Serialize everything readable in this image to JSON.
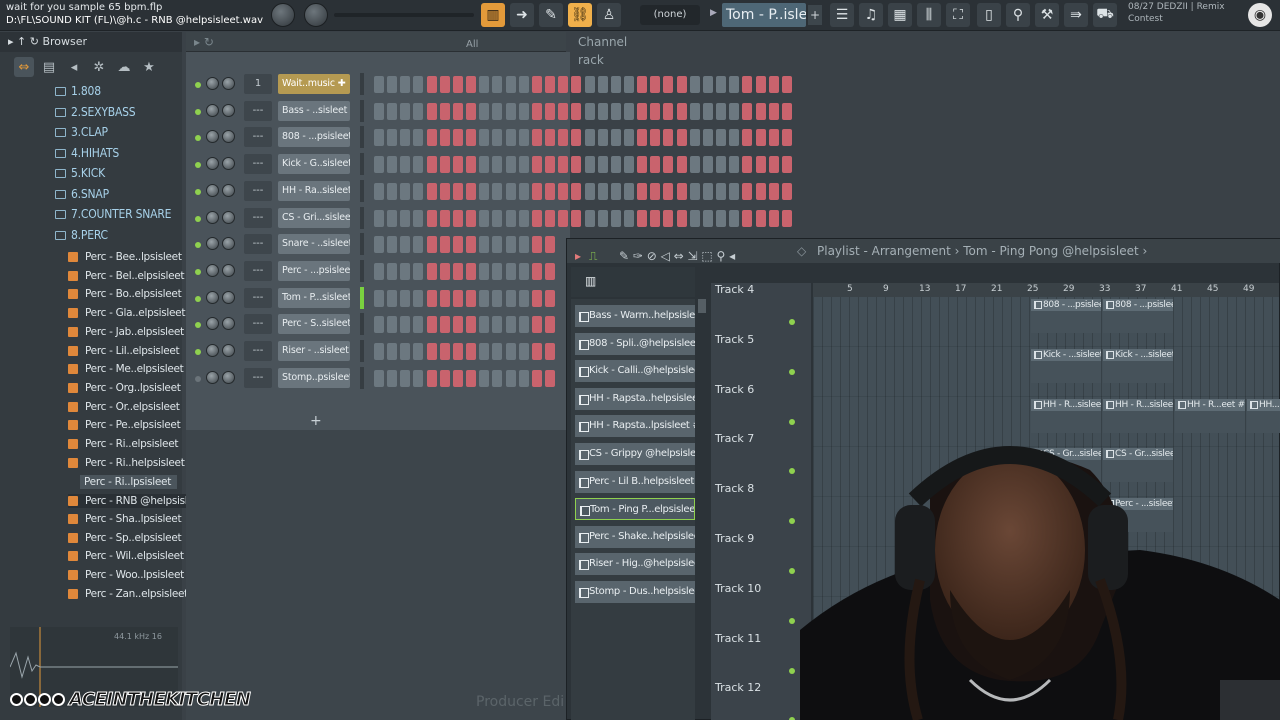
{
  "topbar": {
    "project_title": "wait for you sample 65 bpm.flp",
    "project_path": "D:\\FL\\SOUND KIT (FL)\\@h.c - RNB @helpsisleet.wav",
    "pattern_selector": "(none)",
    "current_pattern": "Tom - P..isleet",
    "news_line1": "08/27 DEDZII | Remix",
    "news_line2": "Contest"
  },
  "browser": {
    "title": "Browser",
    "folders": [
      "1.808",
      "2.SEXYBASS",
      "3.CLAP",
      "4.HIHATS",
      "5.KICK",
      "6.SNAP",
      "7.COUNTER SNARE",
      "8.PERC"
    ],
    "files": [
      "Perc - Bee..lpsisleet",
      "Perc - Bel..elpsisleet",
      "Perc - Bo..elpsisleet",
      "Perc - Gla..elpsisleet",
      "Perc - Jab..elpsisleet",
      "Perc - Lil..elpsisleet",
      "Perc - Me..elpsisleet",
      "Perc - Org..lpsisleet",
      "Perc - Or..elpsisleet",
      "Perc - Pe..elpsisleet",
      "Perc - Ri..elpsisleet",
      "Perc - Ri..helpsisleet"
    ],
    "drag_item": "Perc - Ri..lpsisleet",
    "selected_file": "Perc - RNB @helpsisleet",
    "files_after": [
      "Perc - Sha..lpsisleet",
      "Perc - Sp..elpsisleet",
      "Perc - Wil..elpsisleet",
      "Perc - Woo..lpsisleet",
      "Perc - Zan..elpsisleet"
    ],
    "sample_info": "44.1 kHz 16"
  },
  "channel_rack": {
    "filter": "All",
    "title": "Channel rack",
    "channels": [
      {
        "num": "1",
        "name": "Wait..music",
        "pattern": [
          1,
          1,
          1,
          1,
          1,
          1,
          1,
          1,
          1,
          1,
          1,
          1,
          1,
          1,
          1,
          1,
          1,
          1,
          1,
          1,
          1,
          1,
          1,
          1,
          1,
          1,
          1,
          1,
          1,
          1,
          1,
          1,
          1,
          1,
          1,
          1,
          1,
          1,
          1,
          1,
          1,
          1,
          1,
          1,
          1,
          1,
          1,
          1,
          1,
          1,
          1,
          1,
          1,
          1,
          1,
          1,
          1,
          1,
          1,
          1,
          1,
          1,
          1,
          1
        ]
      },
      {
        "num": "---",
        "name": "Bass - ..sisleet",
        "pattern": [
          0
        ]
      },
      {
        "num": "---",
        "name": "808 - ...psisleet",
        "pattern": [
          0
        ]
      },
      {
        "num": "---",
        "name": "Kick - G..sisleet",
        "pattern": [
          0
        ]
      },
      {
        "num": "---",
        "name": "HH - Ra..sisleet",
        "pattern": [
          0
        ]
      },
      {
        "num": "---",
        "name": "CS - Gri...sisleet",
        "pattern": [
          0
        ]
      },
      {
        "num": "---",
        "name": "Snare - ..sisleet",
        "pattern": [
          0
        ]
      },
      {
        "num": "---",
        "name": "Perc - ...psisleet",
        "pattern": [
          0
        ]
      },
      {
        "num": "---",
        "name": "Tom - P...sisleet",
        "pattern": [
          0
        ]
      },
      {
        "num": "---",
        "name": "Perc - S..sisleet",
        "pattern": [
          0
        ]
      },
      {
        "num": "---",
        "name": "Riser - ..sisleet",
        "pattern": [
          0
        ]
      },
      {
        "num": "---",
        "name": "Stomp..psisleet",
        "pattern": [
          0
        ]
      }
    ],
    "add_label": "+"
  },
  "playlist": {
    "title": "Playlist - Arrangement",
    "pattern_name": "Tom - Ping Pong @helpsisleet",
    "picker": [
      "Bass - Warm..helpsisleet",
      "808 - Spli..@helpsisleet",
      "Kick - Calli..@helpsisleet",
      "HH - Rapsta..helpsisleet",
      "HH - Rapsta..lpsisleet #2",
      "CS - Grippy @helpsisleet",
      "Perc - Lil B..helpsisleet",
      "Tom - Ping P...elpsisleet",
      "Perc - Shake..helpsisleet",
      "Riser - Hig..@helpsisleet",
      "Stomp - Dus..helpsisleet"
    ],
    "picker_selected_index": 7,
    "tracks": [
      "Track 4",
      "Track 5",
      "Track 6",
      "Track 7",
      "Track 8",
      "Track 9",
      "Track 10",
      "Track 11",
      "Track 12"
    ],
    "ruler": [
      "5",
      "9",
      "13",
      "17",
      "21",
      "25",
      "29",
      "33",
      "37",
      "41",
      "45",
      "49"
    ],
    "clips": [
      {
        "track": 0,
        "labels": [
          "808 - ...psisleet",
          "808 - ...psisleet"
        ]
      },
      {
        "track": 1,
        "labels": [
          "Kick - ...sisleet",
          "Kick - ...sisleet"
        ]
      },
      {
        "track": 2,
        "labels": [
          "HH - R...sisleet",
          "HH - R...sisleet",
          "HH - R...eet #2",
          "HH..."
        ]
      },
      {
        "track": 3,
        "labels": [
          "CS - Gr...sisleet",
          "CS - Gr...sisleet"
        ]
      },
      {
        "track": 4,
        "labels": [
          "Perc - ...sisleet",
          "Perc - ...sisleet"
        ]
      },
      {
        "track": 6,
        "labels": [
          "Perc - ...sisleet"
        ]
      },
      {
        "track": 7,
        "labels": [
          "...sisleet",
          "..."
        ]
      }
    ]
  },
  "overlay": {
    "channel_name": "ACEINTHEKITCHEN",
    "watermark": "Producer Edi"
  },
  "colors": {
    "accent_orange": "#e39a3a",
    "step_red": "#c9636d",
    "led_green": "#8fd14f",
    "folder_blue": "#a7d1e9"
  }
}
